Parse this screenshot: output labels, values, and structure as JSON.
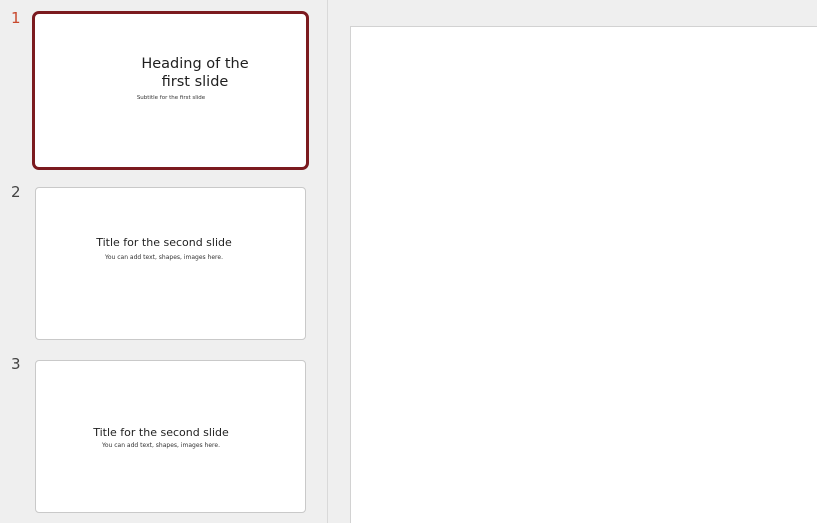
{
  "slides": [
    {
      "number": "1",
      "title": "Heading of the first slide",
      "subtitle": "Subtitle for the first slide",
      "selected": true
    },
    {
      "number": "2",
      "title": "Title for the second slide",
      "subtitle": "You can add text, shapes, images here."
    },
    {
      "number": "3",
      "title": "Title for the second slide",
      "subtitle": "You can add text, shapes, images here."
    }
  ],
  "colors": {
    "selection_border": "#7b1a1f",
    "active_number": "#c8482d",
    "pane_background": "#efefef"
  }
}
